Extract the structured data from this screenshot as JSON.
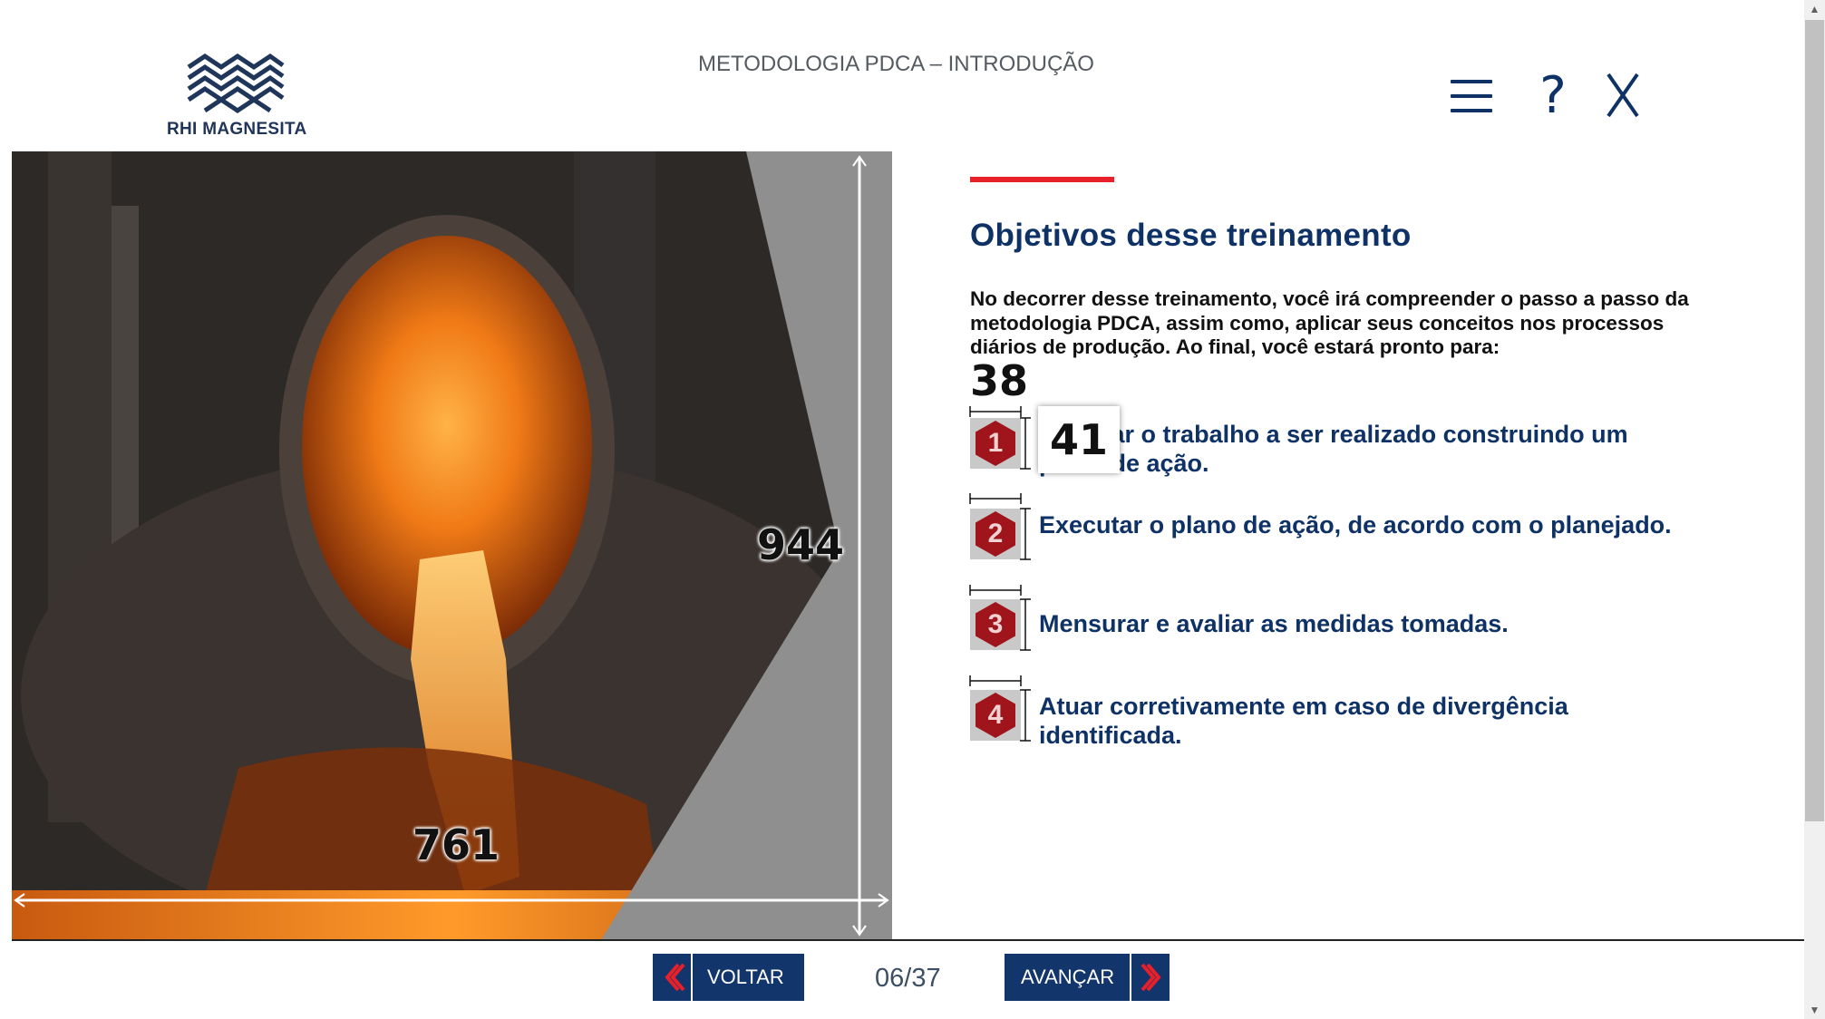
{
  "header": {
    "logo_text": "RHI MAGNESITA",
    "page_title": "METODOLOGIA PDCA – INTRODUÇÃO",
    "help_label": "?"
  },
  "image_panel": {
    "width_label": "761",
    "height_label": "944"
  },
  "content": {
    "title": "Objetivos desse treinamento",
    "intro": "No decorrer desse treinamento, você irá compreender o passo a passo da metodologia PDCA, assim como, aplicar seus conceitos nos processos diários de produção. Ao final, você estará pronto para:",
    "badge_width": "38",
    "badge_tooltip": "41",
    "objectives": [
      {
        "number": "1",
        "text": "Planejar o trabalho a ser realizado construindo um plano de ação."
      },
      {
        "number": "2",
        "text": "Executar o plano de ação, de acordo com o planejado."
      },
      {
        "number": "3",
        "text": "Mensurar e avaliar as medidas tomadas."
      },
      {
        "number": "4",
        "text": "Atuar corretivamente em caso de divergência identificada."
      }
    ]
  },
  "footer": {
    "back_label": "VOLTAR",
    "next_label": "AVANÇAR",
    "page_counter": "06/37"
  },
  "colors": {
    "brand_navy": "#0e3265",
    "accent_red": "#e8202a",
    "hex_red": "#a0141b"
  },
  "icons": [
    "logo-icon",
    "menu-icon",
    "help-icon",
    "close-icon",
    "hexagon-icon",
    "chevron-left-icon",
    "chevron-right-icon"
  ]
}
